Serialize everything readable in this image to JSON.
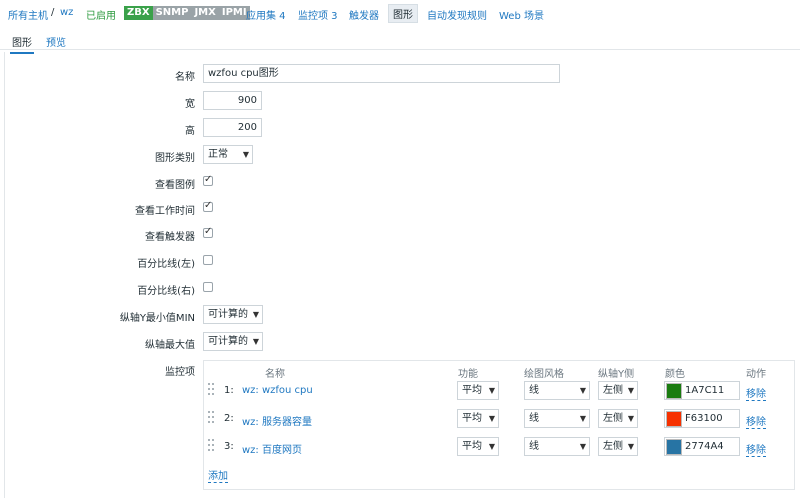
{
  "topnav": {
    "all_hosts": "所有主机",
    "sep": "/",
    "host": "wz",
    "status": "已启用",
    "badges": [
      "ZBX",
      "SNMP",
      "JMX",
      "IPMI"
    ],
    "applications": "应用集 4",
    "items": "监控项 3",
    "triggers": "触发器",
    "graphs": "图形",
    "discovery": "自动发现规则",
    "web": "Web 场景"
  },
  "tabs": {
    "graph": "图形",
    "preview": "预览"
  },
  "form": {
    "name_label": "名称",
    "name_value": "wzfou cpu图形",
    "width_label": "宽",
    "width_value": "900",
    "height_label": "高",
    "height_value": "200",
    "type_label": "图形类别",
    "type_value": "正常",
    "legend_label": "查看图例",
    "legend_checked": true,
    "worktime_label": "查看工作时间",
    "worktime_checked": true,
    "triggers_label": "查看触发器",
    "triggers_checked": true,
    "pleft_label": "百分比线(左)",
    "pleft_checked": false,
    "pright_label": "百分比线(右)",
    "pright_checked": false,
    "ymin_label": "纵轴Y最小值MIN",
    "ymin_value": "可计算的",
    "ymax_label": "纵轴最大值",
    "ymax_value": "可计算的",
    "items_label": "监控项"
  },
  "items_table": {
    "headers": {
      "name": "名称",
      "function": "功能",
      "style": "绘图风格",
      "yaxis": "纵轴Y侧",
      "color": "颜色",
      "action": "动作"
    },
    "rows": [
      {
        "num": "1:",
        "name": "wz: wzfou cpu",
        "function": "平均",
        "style": "线",
        "yaxis": "左侧",
        "color": "1A7C11",
        "action": "移除"
      },
      {
        "num": "2:",
        "name": "wz: 服务器容量",
        "function": "平均",
        "style": "线",
        "yaxis": "左侧",
        "color": "F63100",
        "action": "移除"
      },
      {
        "num": "3:",
        "name": "wz: 百度网页",
        "function": "平均",
        "style": "线",
        "yaxis": "左侧",
        "color": "2774A4",
        "action": "移除"
      }
    ],
    "add": "添加"
  },
  "colors": {
    "link": "#1f78c1",
    "enabled": "#2b9a3e",
    "zbx_badge": "#3aa14a",
    "badge_gray": "#9aa3a7"
  }
}
